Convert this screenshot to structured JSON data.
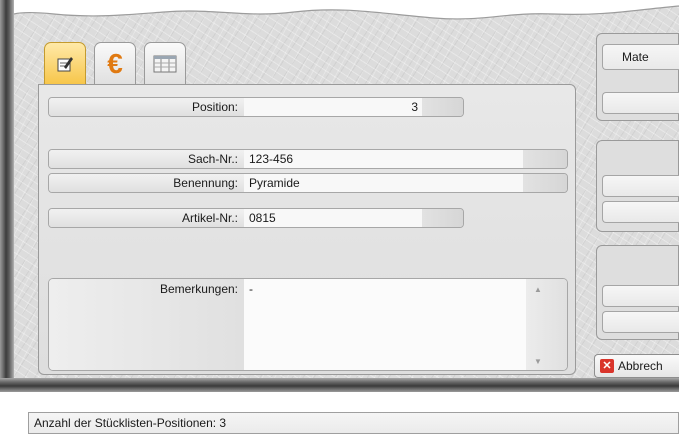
{
  "tabs": [
    {
      "icon": "edit-note-icon",
      "active": true
    },
    {
      "icon": "euro-icon",
      "glyph": "€",
      "active": false
    },
    {
      "icon": "table-view-icon",
      "active": false
    }
  ],
  "form": {
    "position_label": "Position:",
    "position_value": "3",
    "sachnr_label": "Sach-Nr.:",
    "sachnr_value": "123-456",
    "benennung_label": "Benennung:",
    "benennung_value": "Pyramide",
    "artikelnr_label": "Artikel-Nr.:",
    "artikelnr_value": "0815",
    "bemerkungen_label": "Bemerkungen:",
    "bemerkungen_value": "-"
  },
  "right_panel": {
    "material_button": "Mate",
    "cancel_button": "Abbrech"
  },
  "status": {
    "text": "Anzahl der Stücklisten-Positionen: 3"
  },
  "colors": {
    "active_tab": "#f7c64a",
    "euro": "#e07a12",
    "cancel_red": "#d9342b"
  }
}
